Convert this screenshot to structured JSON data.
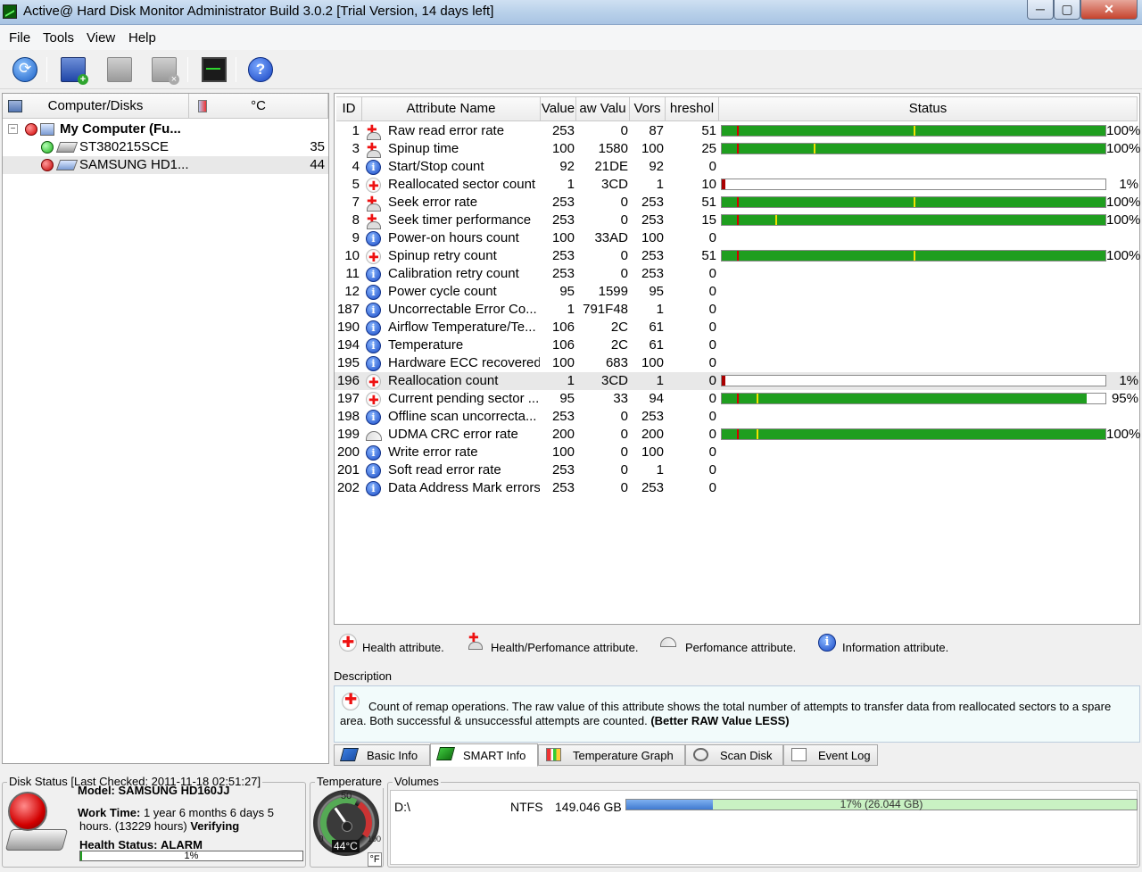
{
  "window": {
    "title": "Active@ Hard Disk Monitor Administrator Build 3.0.2 [Trial Version, 14 days left]",
    "min": "─",
    "max": "▢",
    "close": "✕"
  },
  "menu": [
    "File",
    "Tools",
    "View",
    "Help"
  ],
  "toolbar": [
    "refresh-icon",
    "add-computer-icon",
    "computer-settings-icon",
    "remove-computer-icon",
    "monitor-icon",
    "help-icon"
  ],
  "left": {
    "header_name": "Computer/Disks",
    "header_temp": "°C",
    "root": {
      "label": "My Computer (Fu...",
      "status": "red"
    },
    "disks": [
      {
        "name": "ST380215SCE",
        "temp": "35",
        "status": "green"
      },
      {
        "name": "SAMSUNG HD1...",
        "temp": "44",
        "status": "red"
      }
    ]
  },
  "smart": {
    "headers": {
      "id": "ID",
      "name": "Attribute Name",
      "value": "Value",
      "raw": "aw Valu",
      "worst": "Vors",
      "threshold": "hreshol",
      "status": "Status"
    },
    "rows": [
      {
        "id": "1",
        "type": "hp",
        "name": "Raw read error rate",
        "value": "253",
        "raw": "0",
        "worst": "87",
        "threshold": "51",
        "bar": {
          "pct_text": "100%",
          "fill": 1.0,
          "th": 0.04,
          "wm": 0.5
        }
      },
      {
        "id": "3",
        "type": "hp",
        "name": "Spinup time",
        "value": "100",
        "raw": "1580",
        "worst": "100",
        "threshold": "25",
        "bar": {
          "pct_text": "100%",
          "fill": 1.0,
          "th": 0.04,
          "wm": 0.24
        }
      },
      {
        "id": "4",
        "type": "info",
        "name": "Start/Stop count",
        "value": "92",
        "raw": "21DE",
        "worst": "92",
        "threshold": "0",
        "bar": null
      },
      {
        "id": "5",
        "type": "health",
        "name": "Reallocated sector count",
        "value": "1",
        "raw": "3CD",
        "worst": "1",
        "threshold": "10",
        "bar": {
          "pct_text": "1%",
          "fill": 0.01,
          "low": true
        }
      },
      {
        "id": "7",
        "type": "hp",
        "name": "Seek error rate",
        "value": "253",
        "raw": "0",
        "worst": "253",
        "threshold": "51",
        "bar": {
          "pct_text": "100%",
          "fill": 1.0,
          "th": 0.04,
          "wm": 0.5
        }
      },
      {
        "id": "8",
        "type": "hp",
        "name": "Seek timer performance",
        "value": "253",
        "raw": "0",
        "worst": "253",
        "threshold": "15",
        "bar": {
          "pct_text": "100%",
          "fill": 1.0,
          "th": 0.04,
          "wm": 0.14
        }
      },
      {
        "id": "9",
        "type": "info",
        "name": "Power-on hours count",
        "value": "100",
        "raw": "33AD",
        "worst": "100",
        "threshold": "0",
        "bar": null
      },
      {
        "id": "10",
        "type": "health",
        "name": "Spinup retry count",
        "value": "253",
        "raw": "0",
        "worst": "253",
        "threshold": "51",
        "bar": {
          "pct_text": "100%",
          "fill": 1.0,
          "th": 0.04,
          "wm": 0.5
        }
      },
      {
        "id": "11",
        "type": "info",
        "name": "Calibration retry count",
        "value": "253",
        "raw": "0",
        "worst": "253",
        "threshold": "0",
        "bar": null
      },
      {
        "id": "12",
        "type": "info",
        "name": "Power cycle count",
        "value": "95",
        "raw": "1599",
        "worst": "95",
        "threshold": "0",
        "bar": null
      },
      {
        "id": "187",
        "type": "info",
        "name": "Uncorrectable Error Co...",
        "value": "1",
        "raw": "791F48",
        "worst": "1",
        "threshold": "0",
        "bar": null
      },
      {
        "id": "190",
        "type": "info",
        "name": "Airflow Temperature/Te...",
        "value": "106",
        "raw": "2C",
        "worst": "61",
        "threshold": "0",
        "bar": null
      },
      {
        "id": "194",
        "type": "info",
        "name": "Temperature",
        "value": "106",
        "raw": "2C",
        "worst": "61",
        "threshold": "0",
        "bar": null
      },
      {
        "id": "195",
        "type": "info",
        "name": "Hardware ECC recovered",
        "value": "100",
        "raw": "683",
        "worst": "100",
        "threshold": "0",
        "bar": null
      },
      {
        "id": "196",
        "type": "health",
        "name": "Reallocation count",
        "value": "1",
        "raw": "3CD",
        "worst": "1",
        "threshold": "0",
        "bar": {
          "pct_text": "1%",
          "fill": 0.01,
          "low": true
        },
        "selected": true
      },
      {
        "id": "197",
        "type": "health",
        "name": "Current pending sector ...",
        "value": "95",
        "raw": "33",
        "worst": "94",
        "threshold": "0",
        "bar": {
          "pct_text": "95%",
          "fill": 0.95,
          "th": 0.04,
          "wm": 0.09
        }
      },
      {
        "id": "198",
        "type": "info",
        "name": "Offline scan uncorrecta...",
        "value": "253",
        "raw": "0",
        "worst": "253",
        "threshold": "0",
        "bar": null
      },
      {
        "id": "199",
        "type": "perf",
        "name": "UDMA CRC error rate",
        "value": "200",
        "raw": "0",
        "worst": "200",
        "threshold": "0",
        "bar": {
          "pct_text": "100%",
          "fill": 1.0,
          "th": 0.04,
          "wm": 0.09
        }
      },
      {
        "id": "200",
        "type": "info",
        "name": "Write error rate",
        "value": "100",
        "raw": "0",
        "worst": "100",
        "threshold": "0",
        "bar": null
      },
      {
        "id": "201",
        "type": "info",
        "name": "Soft read error rate",
        "value": "253",
        "raw": "0",
        "worst": "1",
        "threshold": "0",
        "bar": null
      },
      {
        "id": "202",
        "type": "info",
        "name": "Data Address Mark errors",
        "value": "253",
        "raw": "0",
        "worst": "253",
        "threshold": "0",
        "bar": null
      }
    ]
  },
  "legend": {
    "health": "Health attribute.",
    "health_perf": "Health/Perfomance attribute.",
    "perf": "Perfomance attribute.",
    "info": "Information attribute."
  },
  "description": {
    "label": "Description",
    "text": "Count of remap operations. The raw value of this attribute shows the total number of attempts to transfer data from reallocated sectors to a spare area. Both successful & unsuccessful attempts are counted.",
    "hint": "(Better RAW Value LESS)"
  },
  "tabs": [
    "Basic Info",
    "SMART Info",
    "Temperature Graph",
    "Scan Disk",
    "Event Log"
  ],
  "active_tab": 1,
  "disk_status": {
    "title": "Disk Status [Last Checked: 2011-11-18 02:51:27]",
    "model_label": "Model:",
    "model": "SAMSUNG HD160JJ",
    "work_label": "Work Time:",
    "work": "1 year 6 months 6 days 5",
    "work2": "hours. (13229 hours)",
    "verifying": "Verifying",
    "health_label": "Health Status:",
    "health": "ALARM",
    "health_pct": "1%",
    "health_fill": 0.01
  },
  "temperature": {
    "title": "Temperature",
    "reading": "44°C",
    "scale_mid": "50",
    "scale_min": "0",
    "scale_max": "100",
    "unit_btn": "°F"
  },
  "volumes": {
    "title": "Volumes",
    "items": [
      {
        "drive": "D:\\",
        "fs": "NTFS",
        "size": "149.046 GB",
        "usage_text": "17% (26.044 GB)",
        "usage": 0.17
      }
    ]
  },
  "colors": {
    "ok": "#1f9e1f",
    "threshold": "#d40000",
    "worst": "#f2e200",
    "alarm": "#d20000"
  }
}
